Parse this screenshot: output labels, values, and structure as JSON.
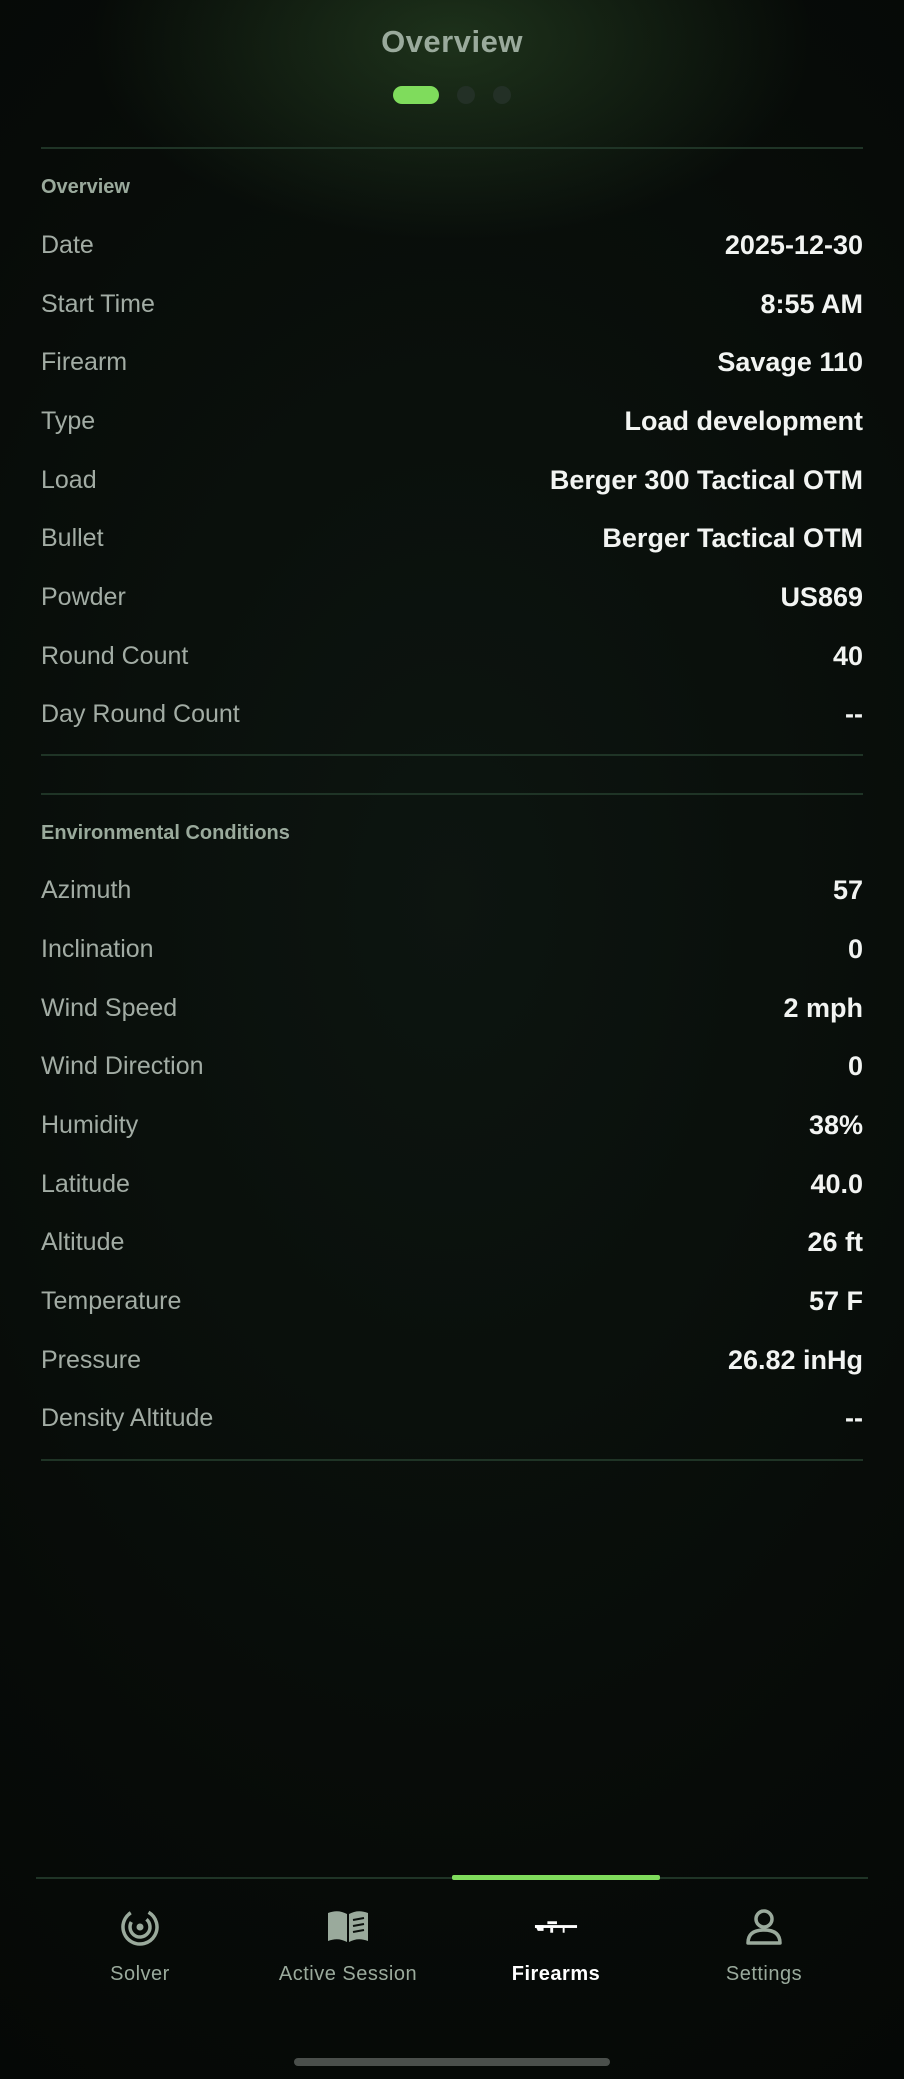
{
  "header": {
    "title": "Overview",
    "pages": 3,
    "active_page": 1
  },
  "overview": {
    "section_title": "Overview",
    "rows": [
      {
        "label": "Date",
        "value": "2025-12-30"
      },
      {
        "label": "Start Time",
        "value": "8:55 AM"
      },
      {
        "label": "Firearm",
        "value": "Savage 110"
      },
      {
        "label": "Type",
        "value": "Load development"
      },
      {
        "label": "Load",
        "value": "Berger 300 Tactical OTM"
      },
      {
        "label": "Bullet",
        "value": "Berger Tactical OTM"
      },
      {
        "label": "Powder",
        "value": "US869"
      },
      {
        "label": "Round Count",
        "value": "40"
      },
      {
        "label": "Day Round Count",
        "value": "--"
      }
    ]
  },
  "environment": {
    "section_title": "Environmental Conditions",
    "rows": [
      {
        "label": "Azimuth",
        "value": "57"
      },
      {
        "label": "Inclination",
        "value": "0"
      },
      {
        "label": "Wind Speed",
        "value": "2 mph"
      },
      {
        "label": "Wind Direction",
        "value": "0"
      },
      {
        "label": "Humidity",
        "value": "38%"
      },
      {
        "label": "Latitude",
        "value": "40.0"
      },
      {
        "label": "Altitude",
        "value": "26 ft"
      },
      {
        "label": "Temperature",
        "value": "57 F"
      },
      {
        "label": "Pressure",
        "value": "26.82 inHg"
      },
      {
        "label": "Density Altitude",
        "value": "--"
      }
    ]
  },
  "nav": {
    "items": [
      {
        "label": "Solver",
        "icon": "solver-icon"
      },
      {
        "label": "Active Session",
        "icon": "book-icon"
      },
      {
        "label": "Firearms",
        "icon": "rifle-icon"
      },
      {
        "label": "Settings",
        "icon": "user-icon"
      }
    ],
    "active": 2
  },
  "colors": {
    "accent": "#7fdc5c",
    "background": "#070b08",
    "label": "#a2aca4",
    "value": "#f2f4f2",
    "divider": "#1f3426"
  }
}
